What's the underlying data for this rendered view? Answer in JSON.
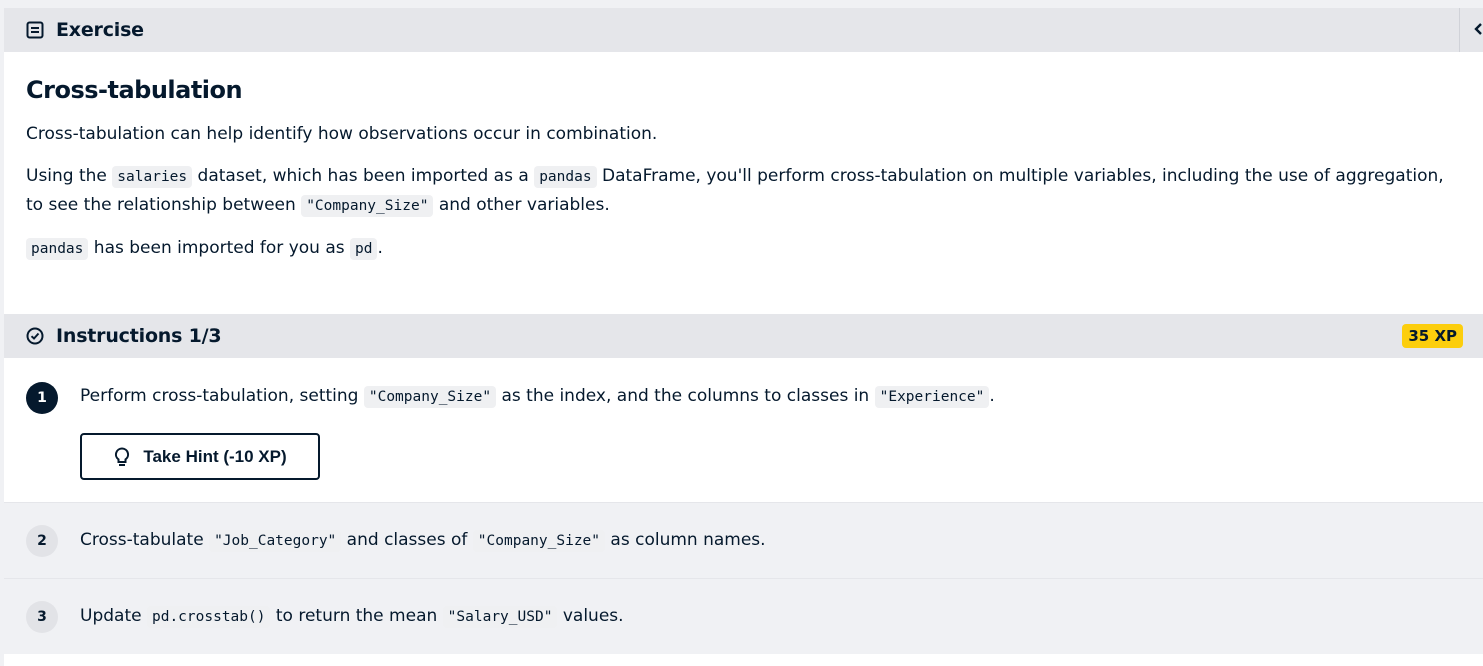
{
  "exercise_header": {
    "label": "Exercise",
    "icon": "document-icon"
  },
  "exercise": {
    "title": "Cross-tabulation",
    "intro": "Cross-tabulation can help identify how observations occur in combination.",
    "para2": {
      "t1": "Using the ",
      "c1": "salaries",
      "t2": " dataset, which has been imported as a ",
      "c2": "pandas",
      "t3": " DataFrame, you'll perform cross-tabulation on multiple variables, including the use of aggregation, to see the relationship between ",
      "c3": "\"Company_Size\"",
      "t4": " and other variables."
    },
    "para3": {
      "c1": "pandas",
      "t1": " has been imported for you as ",
      "c2": "pd",
      "t2": "."
    }
  },
  "instructions": {
    "label": "Instructions 1/3",
    "icon": "check-circle-icon",
    "xp": "35 XP",
    "steps": [
      {
        "num": "1",
        "t1": "Perform cross-tabulation, setting ",
        "c1": "\"Company_Size\"",
        "t2": " as the index, and the columns to classes in ",
        "c2": "\"Experience\"",
        "t3": "."
      },
      {
        "num": "2",
        "t1": "Cross-tabulate ",
        "c1": "\"Job_Category\"",
        "t2": " and classes of ",
        "c2": "\"Company_Size\"",
        "t3": " as column names."
      },
      {
        "num": "3",
        "t1": "Update ",
        "c1": "pd.crosstab()",
        "t2": " to return the mean ",
        "c2": "\"Salary_USD\"",
        "t3": " values."
      }
    ],
    "hint_label": "Take Hint (-10 XP)"
  },
  "colors": {
    "accent": "#fcce0d",
    "navy": "#05192d",
    "header_bg": "#e5e6ea"
  }
}
